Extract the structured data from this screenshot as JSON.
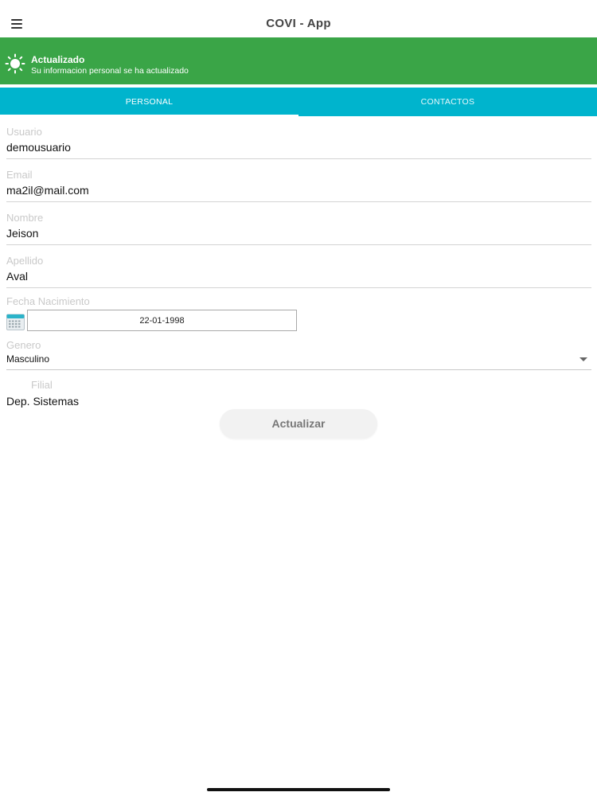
{
  "header": {
    "title": "COVI - App"
  },
  "toast": {
    "title": "Actualizado",
    "message": "Su informacion personal se ha actualizado",
    "color": "#3aa547"
  },
  "tabs": [
    {
      "label": "PERSONAL",
      "active": true
    },
    {
      "label": "CONTACTOS",
      "active": false
    }
  ],
  "accent_color": "#00b4cd",
  "form": {
    "usuario": {
      "label": "Usuario",
      "value": "demousuario"
    },
    "email": {
      "label": "Email",
      "value": "ma2il@mail.com"
    },
    "nombre": {
      "label": "Nombre",
      "value": "Jeison"
    },
    "apellido": {
      "label": "Apellido",
      "value": "Aval"
    },
    "fecha_nacimiento": {
      "label": "Fecha Nacimiento",
      "value": "22-01-1998"
    },
    "genero": {
      "label": "Genero",
      "selected": "Masculino"
    },
    "filial": {
      "label": "Filial",
      "value": "Dep. Sistemas"
    }
  },
  "buttons": {
    "update": "Actualizar"
  },
  "icons": [
    "menu-icon",
    "sun-icon",
    "calendar-icon",
    "chevron-down-icon",
    "battery-icon"
  ]
}
